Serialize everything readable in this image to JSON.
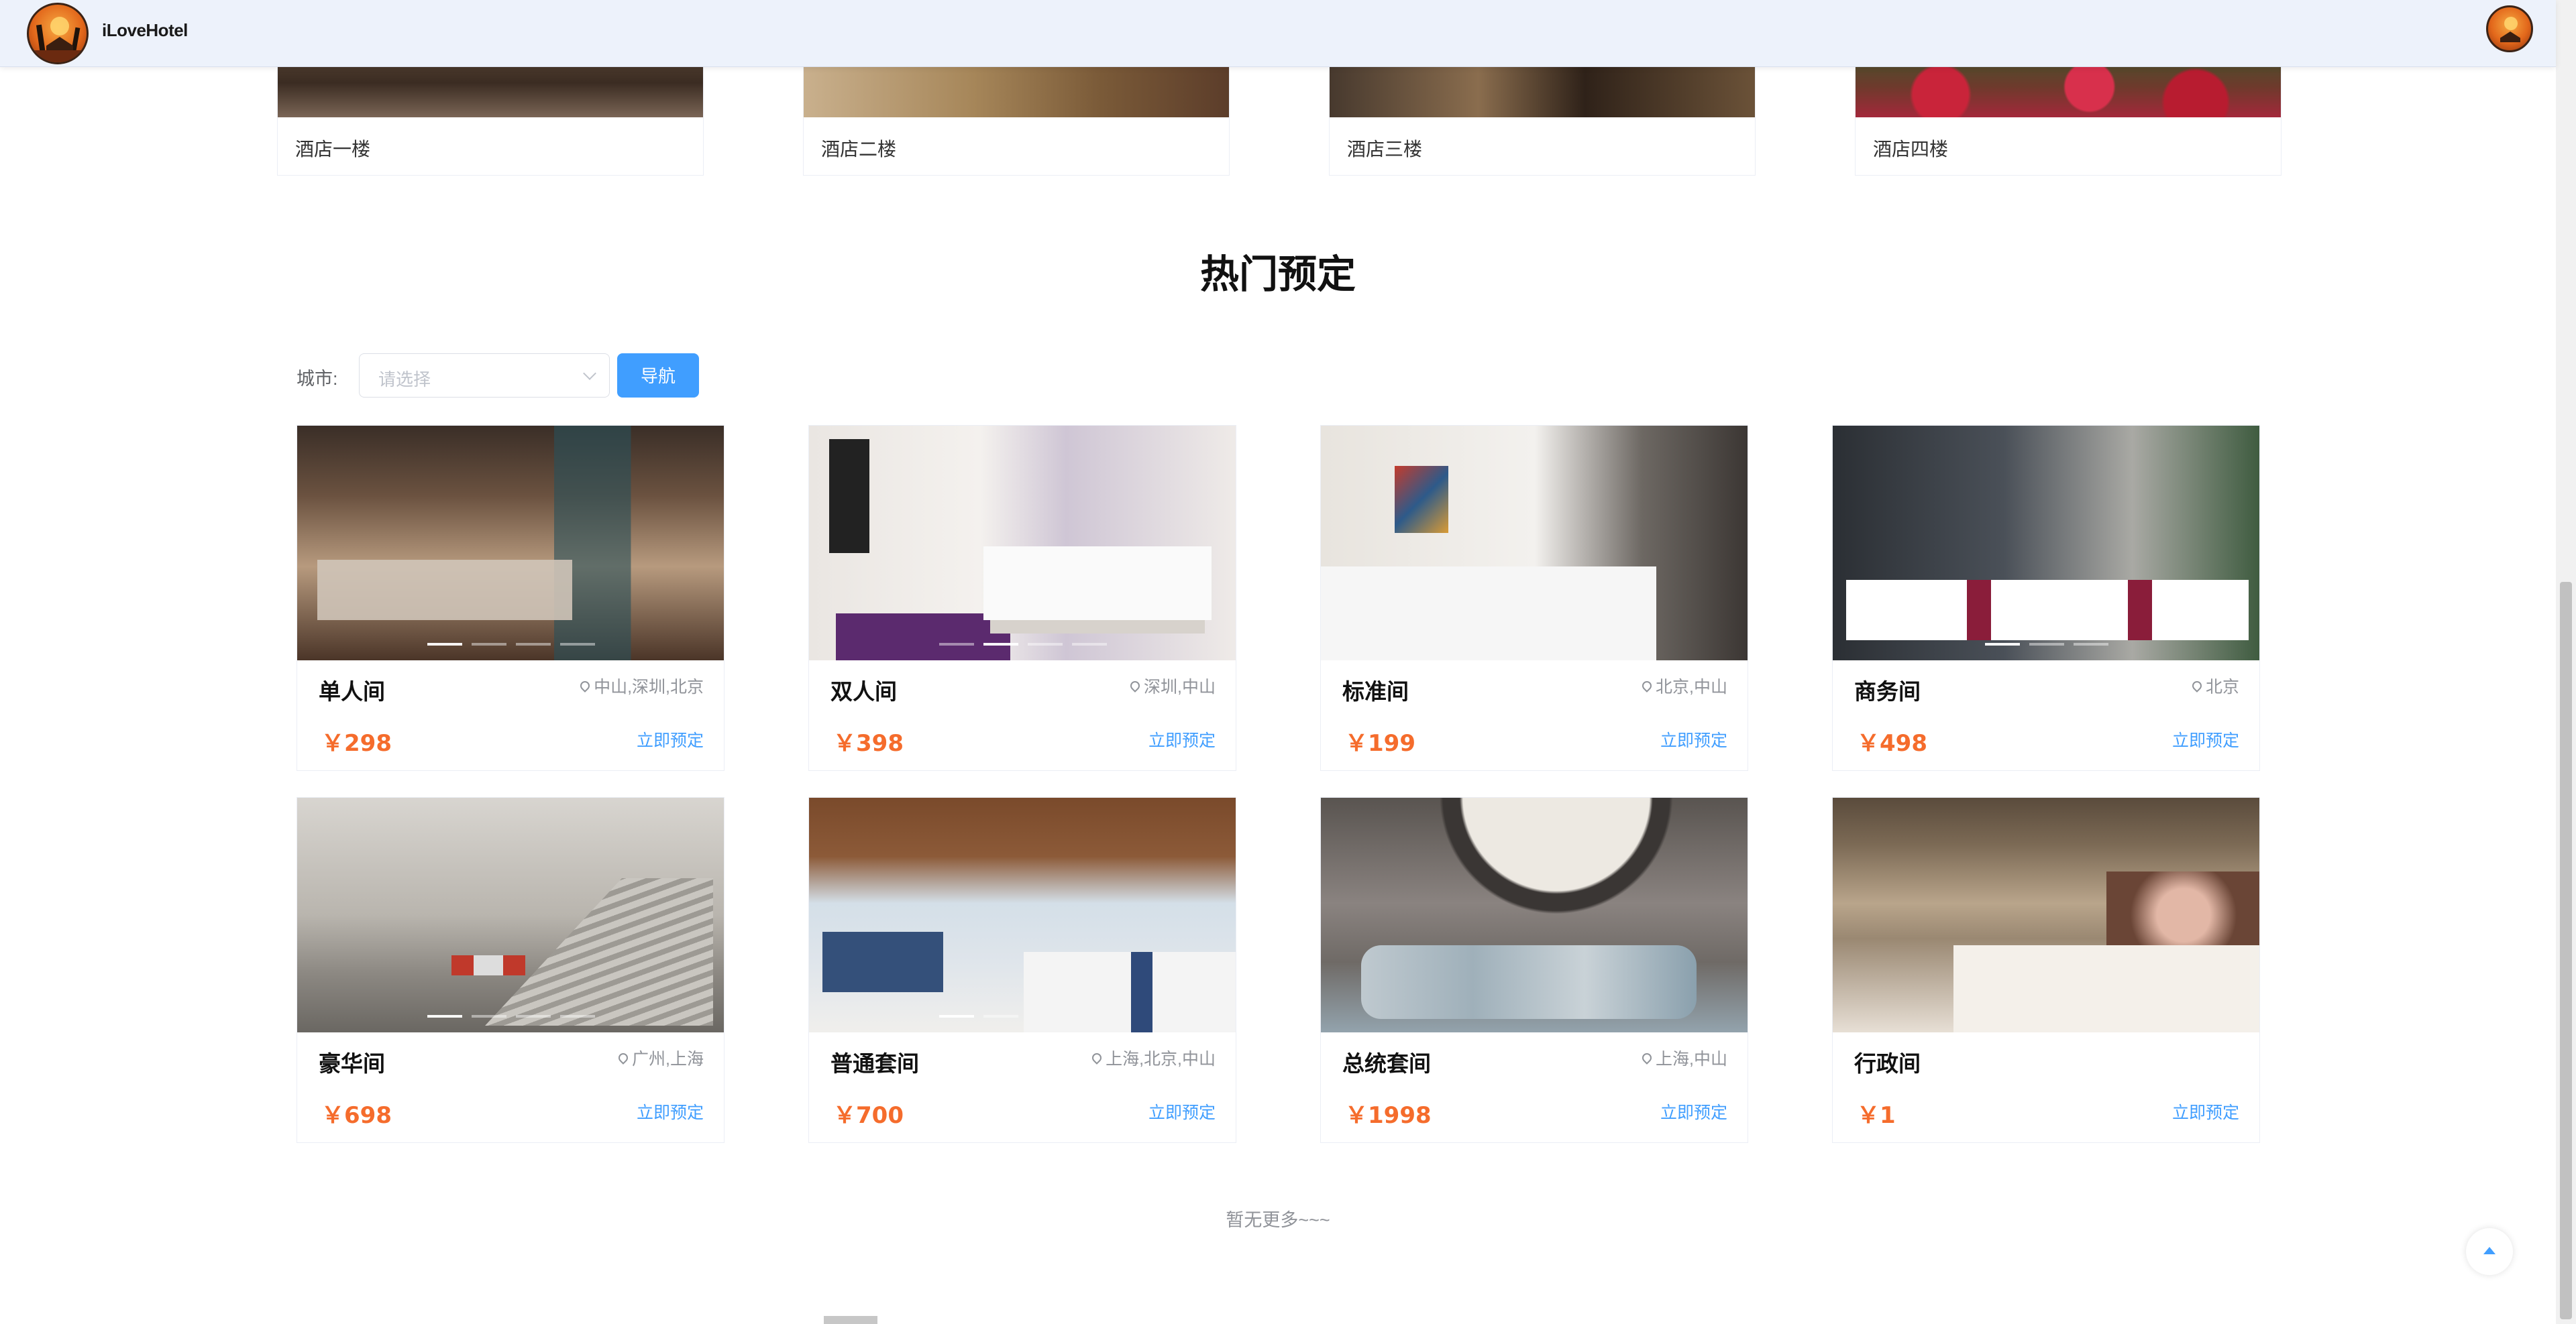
{
  "header": {
    "brand": "iLoveHotel"
  },
  "floors": [
    {
      "label": "酒店一楼"
    },
    {
      "label": "酒店二楼"
    },
    {
      "label": "酒店三楼"
    },
    {
      "label": "酒店四楼"
    }
  ],
  "section": {
    "title": "热门预定"
  },
  "filter": {
    "city_label": "城市:",
    "city_placeholder": "请选择",
    "nav_button": "导航"
  },
  "rooms": [
    {
      "name": "单人间",
      "location": "中山,深圳,北京",
      "price": "￥298",
      "book": "立即预定"
    },
    {
      "name": "双人间",
      "location": "深圳,中山",
      "price": "￥398",
      "book": "立即预定"
    },
    {
      "name": "标准间",
      "location": "北京,中山",
      "price": "￥199",
      "book": "立即预定"
    },
    {
      "name": "商务间",
      "location": "北京",
      "price": "￥498",
      "book": "立即预定"
    },
    {
      "name": "豪华间",
      "location": "广州,上海",
      "price": "￥698",
      "book": "立即预定"
    },
    {
      "name": "普通套间",
      "location": "上海,北京,中山",
      "price": "￥700",
      "book": "立即预定"
    },
    {
      "name": "总统套间",
      "location": "上海,中山",
      "price": "￥1998",
      "book": "立即预定"
    },
    {
      "name": "行政间",
      "location": "",
      "price": "￥1",
      "book": "立即预定"
    }
  ],
  "footer": {
    "no_more": "暂无更多~~~"
  },
  "colors": {
    "accent": "#409eff",
    "price": "#f56c2c",
    "header_bg": "#edf2fb"
  },
  "icons": {
    "logo": "hotel-logo-icon",
    "avatar": "user-avatar-icon",
    "location": "location-pin-icon",
    "backtop": "caret-up-icon"
  }
}
